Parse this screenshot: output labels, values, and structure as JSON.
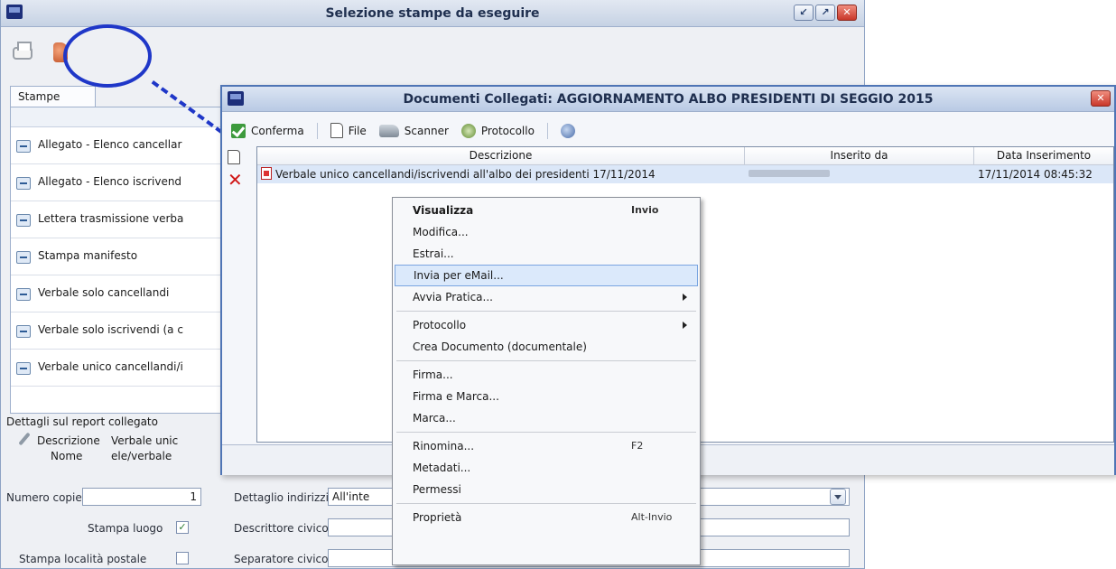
{
  "bg_window": {
    "title": "Selezione stampe da eseguire",
    "tab_label": "Stampe",
    "list_items": [
      "Allegato - Elenco cancellar",
      "Allegato - Elenco iscrivend",
      "Lettera trasmissione verba",
      "Stampa manifesto",
      "Verbale solo cancellandi",
      "Verbale solo iscrivendi (a c",
      "Verbale unico cancellandi/i"
    ],
    "details_label": "Dettagli sul report collegato",
    "description_key": "Descrizione",
    "description_value": "Verbale unic",
    "name_key": "Nome",
    "name_value": "ele/verbale",
    "copies_label": "Numero copie",
    "copies_value": "1",
    "address_detail_label": "Dettaglio indirizzi",
    "address_detail_value": "All'inte",
    "print_place_label": "Stampa luogo",
    "print_place_checked": "✓",
    "civic_descriptor_label": "Descrittore civico",
    "postal_locality_label": "Stampa località postale",
    "civic_separator_label": "Separatore civico",
    "window_buttons": {
      "minimize": "↙",
      "maximize": "↗",
      "close": "✕"
    }
  },
  "dialog": {
    "title": "Documenti Collegati: AGGIORNAMENTO ALBO PRESIDENTI DI SEGGIO 2015",
    "close_glyph": "✕",
    "toolbar": {
      "confirm": "Conferma",
      "file": "File",
      "scanner": "Scanner",
      "protocol": "Protocollo"
    },
    "columns": [
      "Descrizione",
      "Inserito da",
      "Data Inserimento"
    ],
    "rows": [
      {
        "description": "Verbale unico cancellandi/iscrivendi all'albo dei presidenti 17/11/2014",
        "date": "17/11/2014 08:45:32"
      }
    ]
  },
  "context_menu": {
    "items": [
      {
        "label": "Visualizza",
        "shortcut": "Invio"
      },
      {
        "label": "Modifica..."
      },
      {
        "label": "Estrai..."
      },
      {
        "label": "Invia per eMail..."
      },
      {
        "label": "Avvia Pratica..."
      },
      {
        "label": "Protocollo"
      },
      {
        "label": "Crea Documento (documentale)"
      },
      {
        "label": "Firma..."
      },
      {
        "label": "Firma e Marca..."
      },
      {
        "label": "Marca..."
      },
      {
        "label": "Rinomina...",
        "shortcut": "F2"
      },
      {
        "label": "Metadati..."
      },
      {
        "label": "Permessi"
      },
      {
        "label": "Proprietà",
        "shortcut": "Alt-Invio"
      }
    ]
  },
  "colors": {
    "annotation": "#1f37c8",
    "highlight": "#dbe9fb",
    "dialog_border": "#4f75b5"
  }
}
